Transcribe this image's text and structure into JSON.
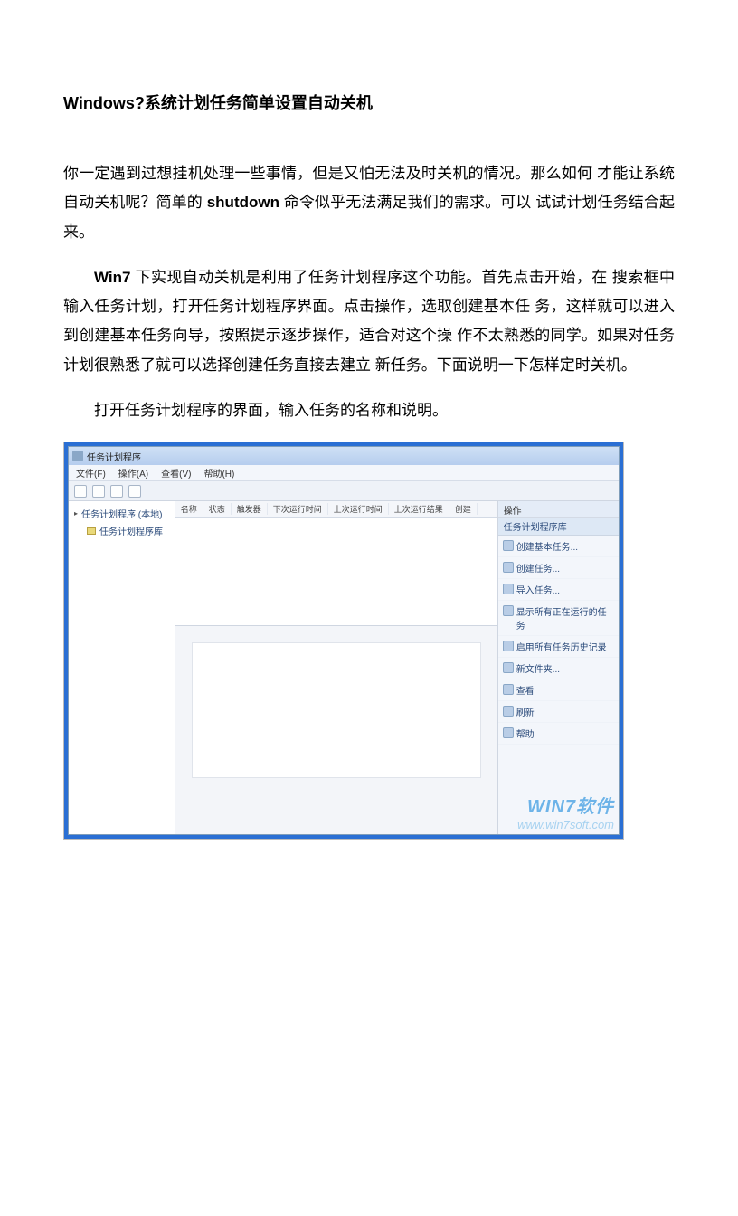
{
  "title_prefix": "Windows?",
  "title_rest": "系统计划任务简单设置自动关机",
  "para1_a": "你一定遇到过想挂机处理一些事情，但是又怕无法及时关机的情况。那么如何 才能让系统自动关机呢？简单的 ",
  "para1_bold": "shutdown",
  "para1_b": " 命令似乎无法满足我们的需求。可以 试试计划任务结合起来。",
  "para2_bold": "Win7",
  "para2_rest": " 下实现自动关机是利用了任务计划程序这个功能。首先点击开始，在 搜索框中输入任务计划，打开任务计划程序界面。点击操作，选取创建基本任 务，这样就可以进入到创建基本任务向导，按照提示逐步操作，适合对这个操 作不太熟悉的同学。如果对任务计划很熟悉了就可以选择创建任务直接去建立 新任务。下面说明一下怎样定时关机。",
  "para3": "打开任务计划程序的界面，输入任务的名称和说明。",
  "screenshot": {
    "window_title": "任务计划程序",
    "menus": [
      "文件(F)",
      "操作(A)",
      "查看(V)",
      "帮助(H)"
    ],
    "tree": {
      "root": "任务计划程序 (本地)",
      "child": "任务计划程序库"
    },
    "columns": [
      "名称",
      "状态",
      "触发器",
      "下次运行时间",
      "上次运行时间",
      "上次运行结果",
      "创建"
    ],
    "actions_header": "操作",
    "actions_subheader": "任务计划程序库",
    "actions": [
      "创建基本任务...",
      "创建任务...",
      "导入任务...",
      "显示所有正在运行的任务",
      "启用所有任务历史记录",
      "新文件夹...",
      "查看",
      "刷新",
      "帮助"
    ],
    "watermark_line1": "WIN7软件",
    "watermark_line2": "www.win7soft.com"
  }
}
